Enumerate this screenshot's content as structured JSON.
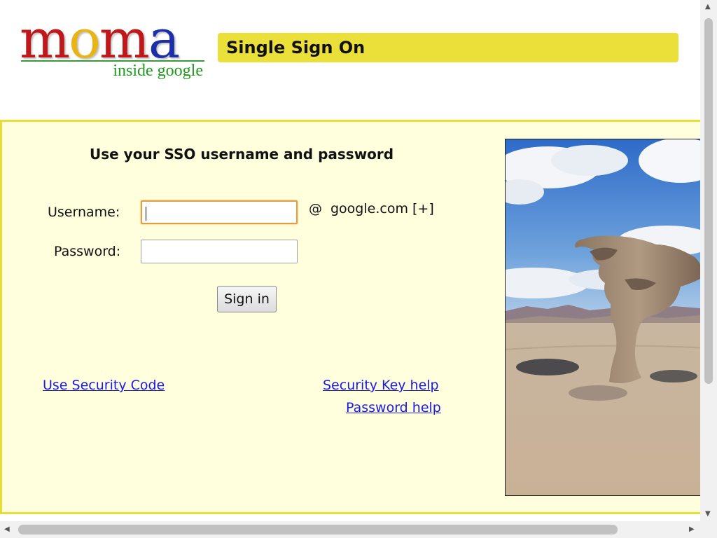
{
  "logo": {
    "letters": [
      "m",
      "o",
      "m",
      "a"
    ],
    "letter_colors": [
      "#c0171a",
      "#e8b416",
      "#c0171a",
      "#1c2fa8"
    ],
    "tagline": "inside google"
  },
  "header": {
    "title": "Single Sign On",
    "accent_color": "#ebe03a"
  },
  "form": {
    "heading": "Use your SSO username and password",
    "username_label": "Username:",
    "username_value": "",
    "password_label": "Password:",
    "password_value": "",
    "domain_at": "@",
    "domain": "google.com [+]",
    "submit_label": "Sign in"
  },
  "links": {
    "security_code": "Use Security Code",
    "security_key_help": "Security Key help",
    "password_help": "Password help"
  },
  "photo": {
    "icon": "desert-rock-tree-photo"
  },
  "colors": {
    "panel_background": "#ffffdd",
    "panel_border": "#e9dd3a",
    "link": "#1a1ae0"
  }
}
